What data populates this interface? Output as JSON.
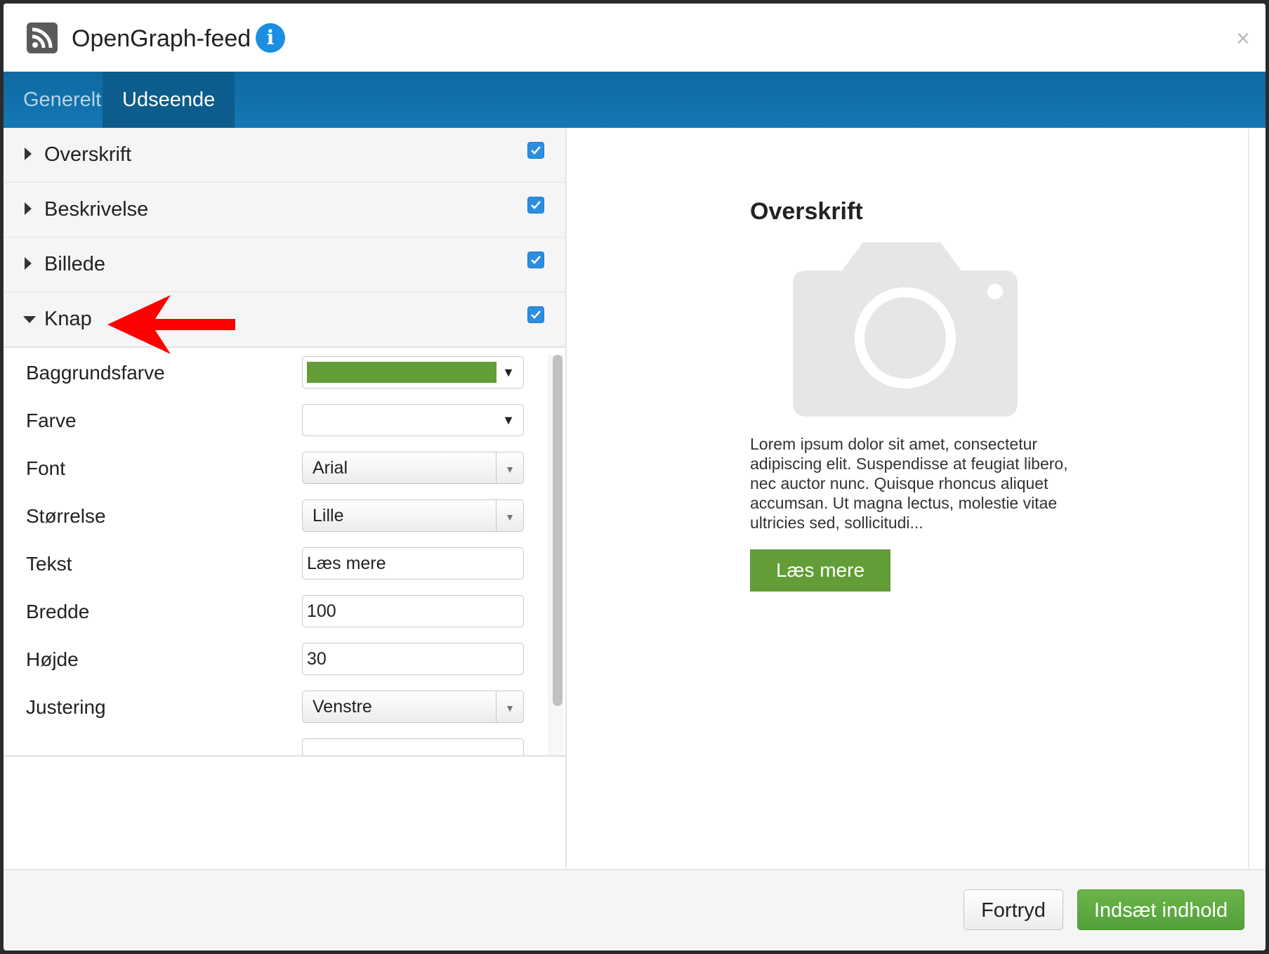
{
  "dialog": {
    "title": "OpenGraph-feed",
    "icon": "rss-icon",
    "info_icon_glyph": "i",
    "close_glyph": "×"
  },
  "tabs": [
    {
      "label": "Generelt",
      "active": false
    },
    {
      "label": "Udseende",
      "active": true
    }
  ],
  "sections": [
    {
      "label": "Overskrift",
      "expanded": false,
      "checked": true
    },
    {
      "label": "Beskrivelse",
      "expanded": false,
      "checked": true
    },
    {
      "label": "Billede",
      "expanded": false,
      "checked": true
    },
    {
      "label": "Knap",
      "expanded": true,
      "checked": true
    }
  ],
  "knap_form": {
    "baggrundsfarve": {
      "label": "Baggrundsfarve",
      "color": "#629d38"
    },
    "farve": {
      "label": "Farve",
      "color": ""
    },
    "font": {
      "label": "Font",
      "value": "Arial"
    },
    "storrelse": {
      "label": "Størrelse",
      "value": "Lille"
    },
    "tekst": {
      "label": "Tekst",
      "value": "Læs mere"
    },
    "bredde": {
      "label": "Bredde",
      "value": "100"
    },
    "hojde": {
      "label": "Højde",
      "value": "30"
    },
    "justering": {
      "label": "Justering",
      "value": "Venstre"
    }
  },
  "preview": {
    "heading": "Overskrift",
    "description": "Lorem ipsum dolor sit amet, consectetur adipiscing elit. Suspendisse at feugiat libero, nec auctor nunc. Quisque rhoncus aliquet accumsan. Ut magna lectus, molestie vitae ultricies sed, sollicitudi...",
    "button_label": "Læs mere",
    "button_color": "#629d38"
  },
  "footer": {
    "cancel_label": "Fortryd",
    "insert_label": "Indsæt indhold"
  },
  "colors": {
    "tab_bar": "#1477b4",
    "checkbox": "#2b8ee0",
    "annotation_arrow": "#ff0000"
  }
}
